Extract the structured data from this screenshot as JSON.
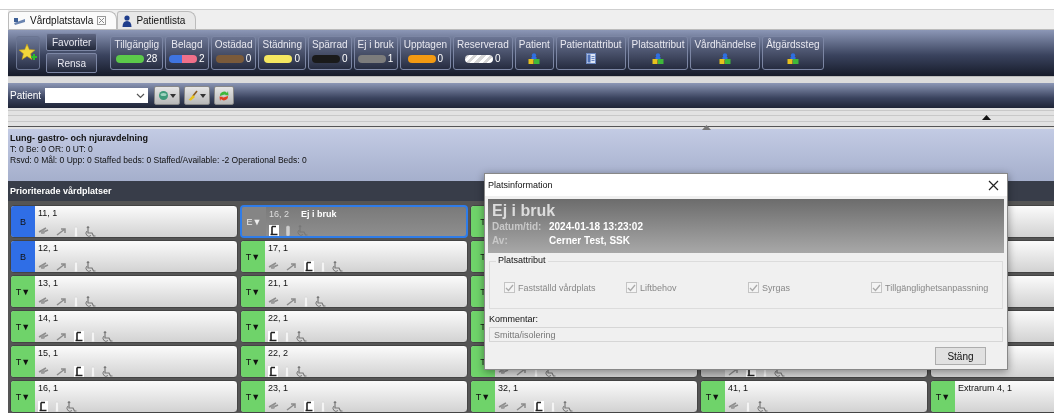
{
  "tabs": [
    {
      "label": "Vårdplatstavla",
      "selected": true,
      "closable": true
    },
    {
      "label": "Patientlista",
      "selected": false,
      "closable": false
    }
  ],
  "toolbar": {
    "favorites": "Favoriter",
    "clear": "Rensa",
    "filters": [
      {
        "label": "Tillgänglig",
        "kind": "count",
        "pill": {
          "kind": "solid",
          "color": "#5cc94a"
        },
        "count": "28"
      },
      {
        "label": "Belagd",
        "kind": "count",
        "pill": {
          "kind": "split",
          "color": "#3f74e0"
        },
        "count": "2"
      },
      {
        "label": "Ostädad",
        "kind": "count",
        "pill": {
          "kind": "solid",
          "color": "#7a5a3a"
        },
        "count": "0"
      },
      {
        "label": "Städning",
        "kind": "count",
        "pill": {
          "kind": "solid",
          "color": "#f5e760"
        },
        "count": "0"
      },
      {
        "label": "Spärrad",
        "kind": "count",
        "pill": {
          "kind": "solid",
          "color": "#1a1a1a"
        },
        "count": "0"
      },
      {
        "label": "Ej i bruk",
        "kind": "count",
        "pill": {
          "kind": "solid",
          "color": "#7c7c7c"
        },
        "count": "1"
      },
      {
        "label": "Upptagen",
        "kind": "count",
        "pill": {
          "kind": "solid",
          "color": "#f39a12"
        },
        "count": "0"
      },
      {
        "label": "Reserverad",
        "kind": "count",
        "pill": {
          "kind": "striped",
          "color": "#d6d6d6"
        },
        "count": "0"
      },
      {
        "label": "Patient",
        "kind": "group"
      },
      {
        "label": "Patientattribut",
        "kind": "list"
      },
      {
        "label": "Platsattribut",
        "kind": "group"
      },
      {
        "label": "Vårdhändelse",
        "kind": "group"
      },
      {
        "label": "Åtgärdssteg",
        "kind": "group"
      }
    ]
  },
  "patient_bar": {
    "label": "Patient"
  },
  "department": {
    "title": "Lung- gastro- och njuravdelning",
    "lines": [
      "T: 0 Be: 0 OR: 0 UT: 0",
      "Rsvd: 0 Mål: 0 Upp: 0 Staffed beds: 0 Staffed/Available: -2 Operational Beds: 0"
    ]
  },
  "section_title": "Prioriterade vårdplatser",
  "beds": [
    [
      {
        "kind": "bed",
        "code": "B",
        "label": "11, 1",
        "color": "#2f6ee6",
        "selected": false,
        "attributes": [
          {
            "kind": "isolation"
          },
          {
            "kind": "lift"
          },
          {
            "kind": "oxygen"
          },
          {
            "kind": "accessible"
          }
        ]
      },
      {
        "kind": "bed",
        "code": "E▼",
        "label": "16, 2",
        "note": "Ej i bruk",
        "color": "#858585",
        "selected": true,
        "attributes": [
          {
            "kind": "fixed"
          },
          {
            "kind": "oxygen"
          },
          {
            "kind": "accessible"
          }
        ]
      },
      {
        "kind": "bed",
        "code": "T",
        "color": "#6fd36a",
        "selected": false
      },
      {
        "kind": "hidden"
      },
      {
        "kind": "covered"
      }
    ],
    [
      {
        "kind": "bed",
        "code": "B",
        "label": "12, 1",
        "color": "#2f6ee6",
        "selected": false,
        "attributes": [
          {
            "kind": "isolation"
          },
          {
            "kind": "lift"
          },
          {
            "kind": "oxygen"
          },
          {
            "kind": "accessible"
          }
        ]
      },
      {
        "kind": "bed",
        "code": "T▼",
        "label": "17, 1",
        "color": "#6fd36a",
        "selected": false,
        "attributes": [
          {
            "kind": "isolation"
          },
          {
            "kind": "lift"
          },
          {
            "kind": "fixed"
          },
          {
            "kind": "oxygen"
          },
          {
            "kind": "accessible"
          }
        ]
      },
      {
        "kind": "bed",
        "code": "T",
        "color": "#6fd36a",
        "selected": false
      },
      {
        "kind": "hidden"
      },
      {
        "kind": "covered"
      }
    ],
    [
      {
        "kind": "bed",
        "code": "T▼",
        "label": "13, 1",
        "color": "#6fd36a",
        "selected": false,
        "attributes": [
          {
            "kind": "isolation"
          },
          {
            "kind": "lift"
          },
          {
            "kind": "oxygen"
          },
          {
            "kind": "accessible"
          }
        ]
      },
      {
        "kind": "bed",
        "code": "T▼",
        "label": "21, 1",
        "color": "#6fd36a",
        "selected": false,
        "attributes": [
          {
            "kind": "isolation"
          },
          {
            "kind": "lift"
          },
          {
            "kind": "oxygen"
          },
          {
            "kind": "accessible"
          }
        ]
      },
      {
        "kind": "bed",
        "code": "T",
        "color": "#6fd36a",
        "selected": false
      },
      {
        "kind": "hidden"
      },
      {
        "kind": "covered"
      }
    ],
    [
      {
        "kind": "bed",
        "code": "T▼",
        "label": "14, 1",
        "color": "#6fd36a",
        "selected": false,
        "attributes": [
          {
            "kind": "isolation"
          },
          {
            "kind": "lift"
          },
          {
            "kind": "fixed"
          },
          {
            "kind": "oxygen"
          },
          {
            "kind": "accessible"
          }
        ]
      },
      {
        "kind": "bed",
        "code": "T▼",
        "label": "22, 1",
        "color": "#6fd36a",
        "selected": false,
        "attributes": [
          {
            "kind": "fixed"
          },
          {
            "kind": "oxygen"
          },
          {
            "kind": "accessible"
          }
        ]
      },
      {
        "kind": "bed",
        "code": "T",
        "color": "#6fd36a",
        "selected": false
      },
      {
        "kind": "hidden"
      },
      {
        "kind": "covered"
      }
    ],
    [
      {
        "kind": "bed",
        "code": "T▼",
        "label": "15, 1",
        "color": "#6fd36a",
        "selected": false,
        "attributes": [
          {
            "kind": "isolation"
          },
          {
            "kind": "lift"
          },
          {
            "kind": "fixed"
          },
          {
            "kind": "oxygen"
          },
          {
            "kind": "accessible"
          }
        ]
      },
      {
        "kind": "bed",
        "code": "T▼",
        "label": "22, 2",
        "color": "#6fd36a",
        "selected": false,
        "attributes": [
          {
            "kind": "fixed"
          },
          {
            "kind": "oxygen"
          },
          {
            "kind": "accessible"
          }
        ]
      },
      {
        "kind": "bed",
        "code": "T",
        "color": "#6fd36a",
        "selected": false,
        "attributes": [
          {
            "kind": "isolation"
          },
          {
            "kind": "lift"
          },
          {
            "kind": "oxygen"
          },
          {
            "kind": "accessible"
          }
        ]
      },
      {
        "kind": "bed",
        "selected": false,
        "attributes": [
          {
            "kind": "lift"
          },
          {
            "kind": "fixed"
          },
          {
            "kind": "oxygen"
          },
          {
            "kind": "accessible"
          }
        ]
      },
      {
        "kind": "covered"
      }
    ],
    [
      {
        "kind": "bed",
        "code": "T▼",
        "label": "16, 1",
        "color": "#6fd36a",
        "selected": false,
        "attributes": [
          {
            "kind": "fixed"
          },
          {
            "kind": "oxygen"
          },
          {
            "kind": "accessible"
          }
        ]
      },
      {
        "kind": "bed",
        "code": "T▼",
        "label": "23, 1",
        "color": "#6fd36a",
        "selected": false,
        "attributes": [
          {
            "kind": "isolation"
          },
          {
            "kind": "lift"
          },
          {
            "kind": "fixed"
          },
          {
            "kind": "oxygen"
          },
          {
            "kind": "accessible"
          }
        ]
      },
      {
        "kind": "bed",
        "code": "T▼",
        "label": "32, 1",
        "color": "#6fd36a",
        "selected": false,
        "attributes": [
          {
            "kind": "isolation"
          },
          {
            "kind": "lift"
          },
          {
            "kind": "fixed"
          },
          {
            "kind": "oxygen"
          },
          {
            "kind": "accessible"
          }
        ]
      },
      {
        "kind": "bed",
        "code": "T▼",
        "label": "41, 1",
        "color": "#6fd36a",
        "selected": false,
        "attributes": [
          {
            "kind": "isolation"
          },
          {
            "kind": "oxygen"
          },
          {
            "kind": "accessible"
          }
        ]
      },
      {
        "kind": "bed",
        "code": "T▼",
        "label": "Extrarum 4, 1",
        "color": "#6fd36a",
        "selected": false
      }
    ]
  ],
  "dialog": {
    "title": "Platsinformation",
    "status": "Ej i bruk",
    "details": [
      {
        "label": "Datum/tid:",
        "value": "2024-01-18 13:23:02"
      },
      {
        "label": "Av:",
        "value": "Cerner Test, SSK"
      }
    ],
    "group_title": "Platsattribut",
    "attributes": [
      {
        "label": "Fastställd vårdplats",
        "checked": true,
        "disabled": true
      },
      {
        "label": "Liftbehov",
        "checked": true,
        "disabled": true
      },
      {
        "label": "Syrgas",
        "checked": true,
        "disabled": true
      },
      {
        "label": "Tillgänglighetsanpassning",
        "checked": true,
        "disabled": true
      }
    ],
    "comment_label": "Kommentar:",
    "comment": "Smitta/isolering",
    "close_button": "Stäng"
  }
}
